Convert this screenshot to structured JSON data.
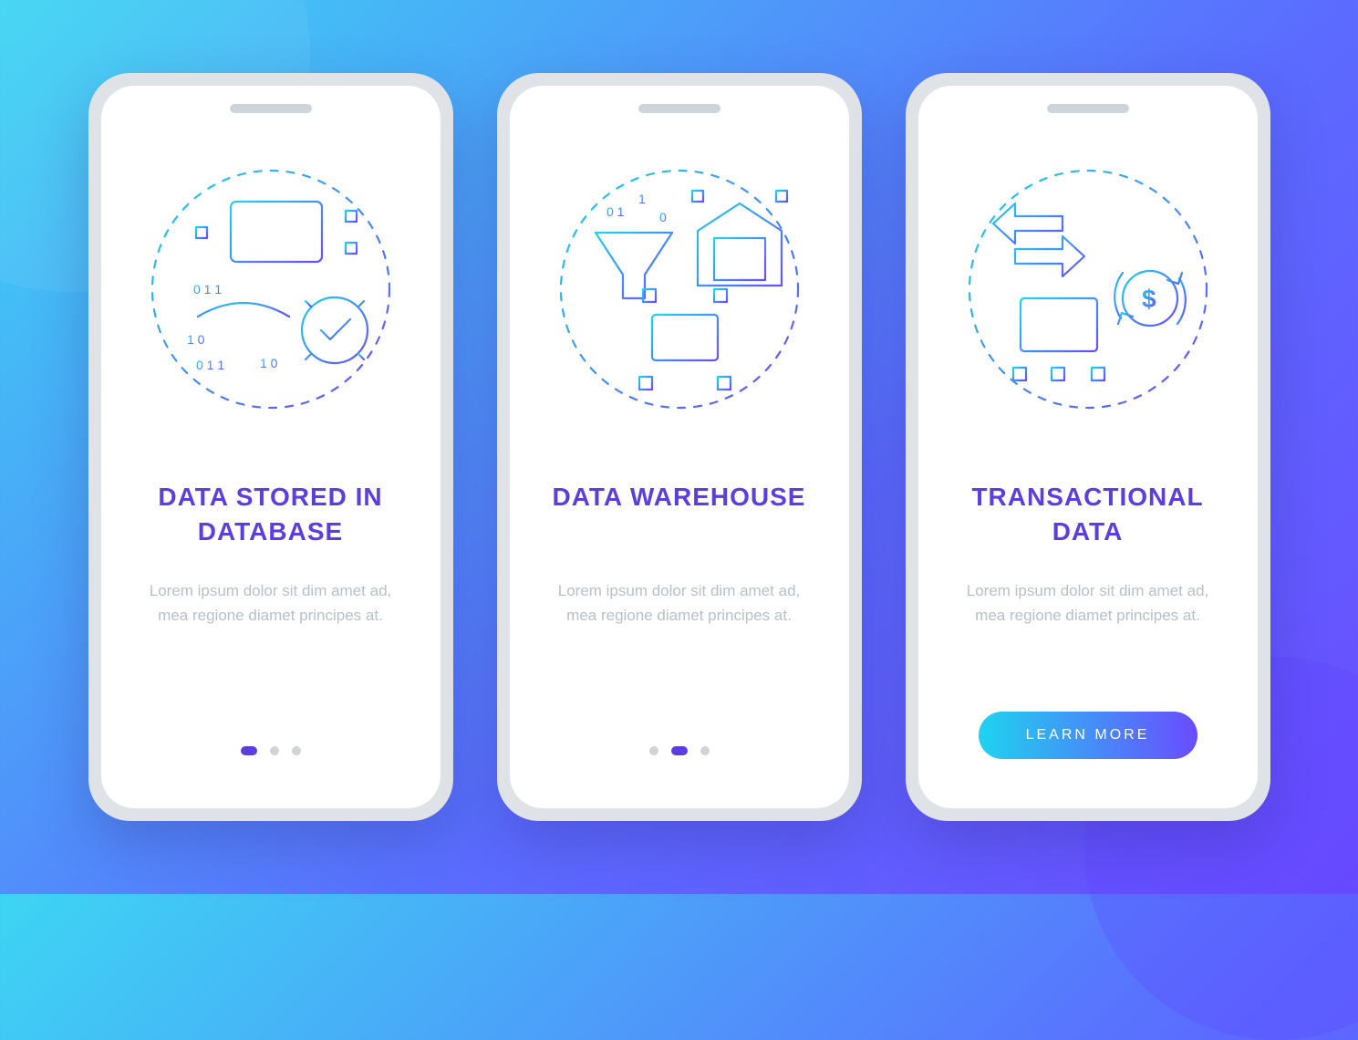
{
  "colors": {
    "accent": "#5b3de0",
    "grad_start": "#1fd3ef",
    "grad_end": "#6a4cff",
    "text_muted": "#b8bfc8"
  },
  "cta_label": "LEARN MORE",
  "screens": [
    {
      "icon": "database-mining-icon",
      "title": "DATA STORED IN DATABASE",
      "desc": "Lorem ipsum dolor sit dim amet ad, mea regione diamet principes at.",
      "page_index": 0,
      "total_pages": 3,
      "cta": false
    },
    {
      "icon": "data-warehouse-icon",
      "title": "DATA WAREHOUSE",
      "desc": "Lorem ipsum dolor sit dim amet ad, mea regione diamet principes at.",
      "page_index": 1,
      "total_pages": 3,
      "cta": false
    },
    {
      "icon": "transactional-data-icon",
      "title": "TRANSACTIONAL DATA",
      "desc": "Lorem ipsum dolor sit dim amet ad, mea regione diamet principes at.",
      "page_index": 2,
      "total_pages": 3,
      "cta": true
    }
  ]
}
